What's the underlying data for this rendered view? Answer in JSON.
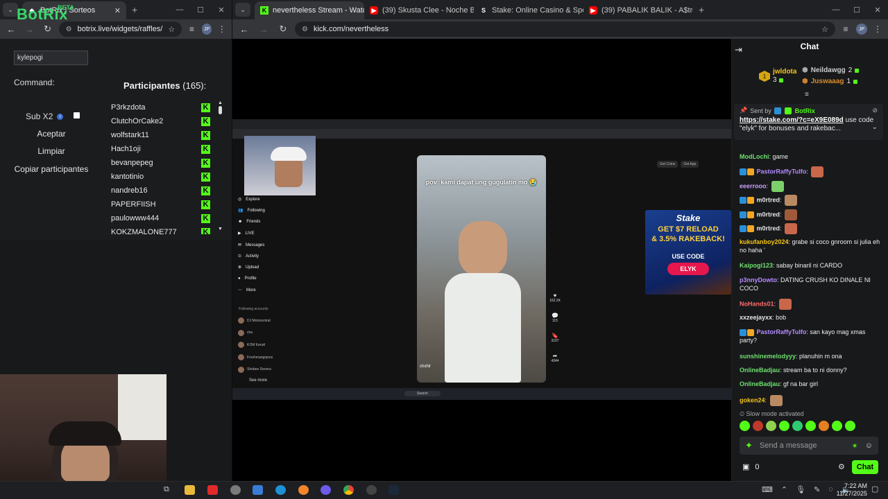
{
  "left_window": {
    "tabs": [
      {
        "title": "BotRix | Sorteos"
      }
    ],
    "url": "botrix.live/widgets/raffles/",
    "profile": "JP"
  },
  "botrix": {
    "logo": "BotRix",
    "beta": "BETA",
    "command_label": "Command:",
    "command_value": "kylepogi",
    "sub_label": "Sub X2",
    "accept": "Aceptar",
    "clear": "Limpiar",
    "copy": "Copiar participantes",
    "participants_title": "Participantes",
    "participants_count": "(165):",
    "participants": [
      "P3rkzdota",
      "ClutchOrCake2",
      "wolfstark11",
      "Hach1oji",
      "bevanpepeg",
      "kantotinio",
      "nandreb16",
      "PAPERFIISH",
      "paulowww444",
      "KOKZMALONE777"
    ]
  },
  "right_window": {
    "tabs": [
      {
        "title": "nevertheless Stream - Watch Li"
      },
      {
        "title": "(39) Skusta Clee - Noche Buena"
      },
      {
        "title": "Stake: Online Casino & Sports"
      },
      {
        "title": "(39) PABALIK BALIK - A$tro"
      }
    ],
    "url": "kick.com/nevertheless",
    "profile": "JP"
  },
  "video": {
    "caption": "pov: kami dapat ung gugulatin mo 😭",
    "tiktok_nav": [
      "Explore",
      "Following",
      "Friends",
      "LIVE",
      "Messages",
      "Activity",
      "Upload",
      "Profile",
      "More"
    ],
    "following_title": "Following accounts",
    "following": [
      "DJ Motocentral",
      "cha",
      "KOM Kenzil",
      "Freshmangojoos",
      "Shobee Devera"
    ],
    "see_more": "See more",
    "video_user": "chxhlr",
    "counts": [
      "162.2K",
      "115",
      "3107",
      "4344"
    ],
    "get_coins": "Get Coins",
    "get_app": "Get App",
    "ad": {
      "brand": "Stake",
      "line1": "GET $7 RELOAD",
      "line2": "& 3.5% RAKEBACK!",
      "use_code": "USE CODE",
      "code": "ELYK"
    },
    "taskbar_search": "Search"
  },
  "chat": {
    "title": "Chat",
    "leaderboard": [
      {
        "name": "jwldota",
        "count": "3"
      },
      {
        "name": "Neildawgg",
        "count": "2"
      },
      {
        "name": "Juswaaag",
        "count": "1"
      }
    ],
    "pinned_by": "Sent by",
    "pinned_user": "BotRix",
    "pinned_link": "https://stake.com/?c=eX9E089d",
    "pinned_text": " use code \"elyk\" for bonuses and rakebac...",
    "messages": [
      {
        "user": "ModLochi",
        "text": "game",
        "color": "#6ee06e"
      },
      {
        "user": "PastorRaffyTulfo",
        "text": "",
        "color": "#b48cff"
      },
      {
        "user": "eeerrooo",
        "text": "",
        "color": "#c9a0ff"
      },
      {
        "user": "m0rtred",
        "text": "",
        "color": "#e6e6e6"
      },
      {
        "user": "m0rtred",
        "text": "",
        "color": "#e6e6e6"
      },
      {
        "user": "m0rtred",
        "text": "",
        "color": "#e6e6e6"
      },
      {
        "user": "kukufanboy2024",
        "text": "grabe si coco gnroom si julia eh no haha '",
        "color": "#f5c518"
      },
      {
        "user": "Kaipogi123",
        "text": "sabay binaril ni CARDO",
        "color": "#6ee06e"
      },
      {
        "user": "p3nnyDowto",
        "text": "DATING CRUSH KO DINALE NI COCO",
        "color": "#b48cff"
      },
      {
        "user": "NoHands01",
        "text": "",
        "color": "#ff6b6b"
      },
      {
        "user": "xxzeejayxx",
        "text": "bob",
        "color": "#e6e6e6"
      },
      {
        "user": "PastorRaffyTulfo",
        "text": "san kayo mag xmas party?",
        "color": "#b48cff"
      },
      {
        "user": "sunshinemelodyyy",
        "text": "planuhin m ona",
        "color": "#6ee06e"
      },
      {
        "user": "OnlineBadjau",
        "text": "stream ba to ni donny?",
        "color": "#6ee06e"
      },
      {
        "user": "OnlineBadjau",
        "text": "gf na bar girl",
        "color": "#6ee06e"
      },
      {
        "user": "goken24",
        "text": "",
        "color": "#f5c518"
      }
    ],
    "slow_mode": "Slow mode activated",
    "placeholder": "Send a message",
    "points": "0",
    "chat_button": "Chat"
  },
  "taskbar": {
    "time": "7:22 AM",
    "date": "11/27/2025"
  }
}
